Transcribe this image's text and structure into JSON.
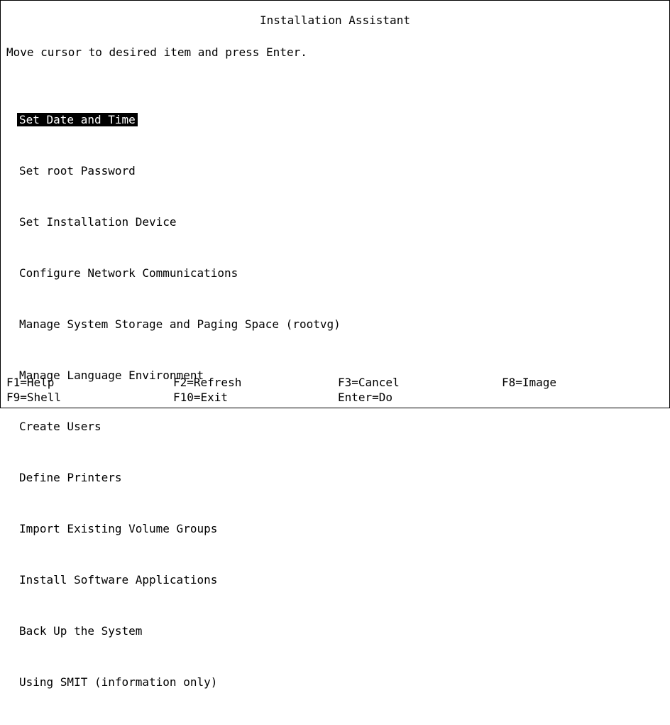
{
  "title": "Installation Assistant",
  "instructions": "Move cursor to desired item and press Enter.",
  "menu": {
    "selected_index": 0,
    "items": [
      "Set Date and Time",
      "Set root Password",
      "Set Installation Device",
      "Configure Network Communications",
      "Manage System Storage and Paging Space (rootvg)",
      "Manage Language Environment",
      "Create Users",
      "Define Printers",
      "Import Existing Volume Groups",
      "Install Software Applications",
      "Back Up the System",
      "Using SMIT (information only)"
    ]
  },
  "function_keys": {
    "f1": "F1=Help",
    "f2": "F2=Refresh",
    "f3": "F3=Cancel",
    "f8": "F8=Image",
    "f9": "F9=Shell",
    "f10": "F10=Exit",
    "enter": "Enter=Do"
  }
}
